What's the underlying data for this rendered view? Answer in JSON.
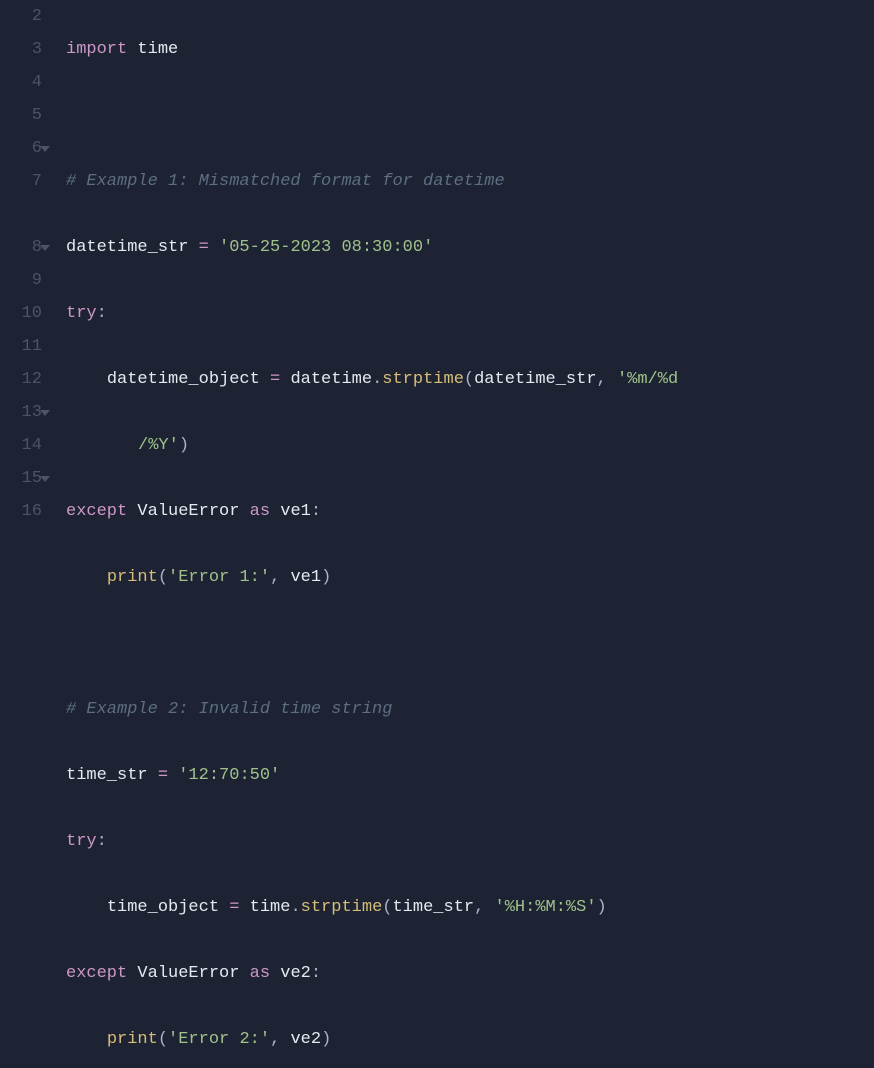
{
  "gutter": {
    "lines": [
      "2",
      "3",
      "4",
      "5",
      "6",
      "7",
      "",
      "8",
      "9",
      "10",
      "11",
      "12",
      "13",
      "14",
      "15",
      "16"
    ],
    "folds": [
      false,
      false,
      false,
      false,
      true,
      false,
      false,
      true,
      false,
      false,
      false,
      false,
      true,
      false,
      true,
      false
    ]
  },
  "code": {
    "l2": {
      "import": "import",
      "time": "time"
    },
    "l4": {
      "comment": "# Example 1: Mismatched format for datetime"
    },
    "l5": {
      "var": "datetime_str",
      "eq": "=",
      "val": "'05-25-2023 08:30:00'"
    },
    "l6": {
      "try": "try",
      "colon": ":"
    },
    "l7": {
      "var": "datetime_object",
      "eq": "=",
      "mod": "datetime",
      "dot": ".",
      "fn": "strptime",
      "open": "(",
      "arg1": "datetime_str",
      "comma": ",",
      "arg2a": "'%m/%d",
      "arg2b": "/%Y'",
      "close": ")"
    },
    "l8": {
      "except": "except",
      "err": "ValueError",
      "as": "as",
      "var": "ve1",
      "colon": ":"
    },
    "l9": {
      "fn": "print",
      "open": "(",
      "str": "'Error 1:'",
      "comma": ",",
      "arg": "ve1",
      "close": ")"
    },
    "l11": {
      "comment": "# Example 2: Invalid time string"
    },
    "l12": {
      "var": "time_str",
      "eq": "=",
      "val": "'12:70:50'"
    },
    "l13": {
      "try": "try",
      "colon": ":"
    },
    "l14": {
      "var": "time_object",
      "eq": "=",
      "mod": "time",
      "dot": ".",
      "fn": "strptime",
      "open": "(",
      "arg1": "time_str",
      "comma": ",",
      "arg2": "'%H:%M:%S'",
      "close": ")"
    },
    "l15": {
      "except": "except",
      "err": "ValueError",
      "as": "as",
      "var": "ve2",
      "colon": ":"
    },
    "l16": {
      "fn": "print",
      "open": "(",
      "str": "'Error 2:'",
      "comma": ",",
      "arg": "ve2",
      "close": ")"
    }
  }
}
